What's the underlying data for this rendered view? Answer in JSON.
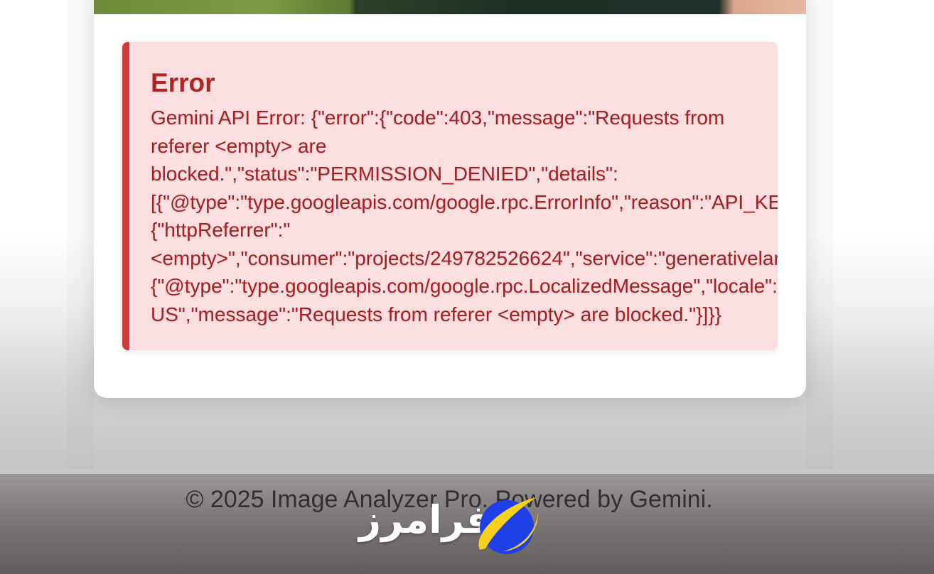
{
  "error_panel": {
    "title": "Error",
    "message_lines": [
      "Gemini API Error: {\"error\":{\"code\":403,\"message\":\"Requests from",
      "referer <empty> are",
      "blocked.\",\"status\":\"PERMISSION_DENIED\",\"details\":",
      "[{\"@type\":\"type.googleapis.com/google.rpc.ErrorInfo\",\"reason\":\"API_KEY",
      "{\"httpReferrer\":\"",
      "<empty>\",\"consumer\":\"projects/249782526624\",\"service\":\"generativelan",
      "{\"@type\":\"type.googleapis.com/google.rpc.LocalizedMessage\",\"locale\":",
      "US\",\"message\":\"Requests from referer <empty> are blocked.\"}]}}"
    ]
  },
  "footer": {
    "copyright": "© 2025 Image Analyzer Pro. Powered by Gemini."
  },
  "watermark": {
    "text": "فرامرز",
    "icon": "blue-planet-logo-icon"
  },
  "colors": {
    "error_accent": "#d23b3b",
    "error_background": "#fbdfe0",
    "error_text": "#a22222"
  }
}
